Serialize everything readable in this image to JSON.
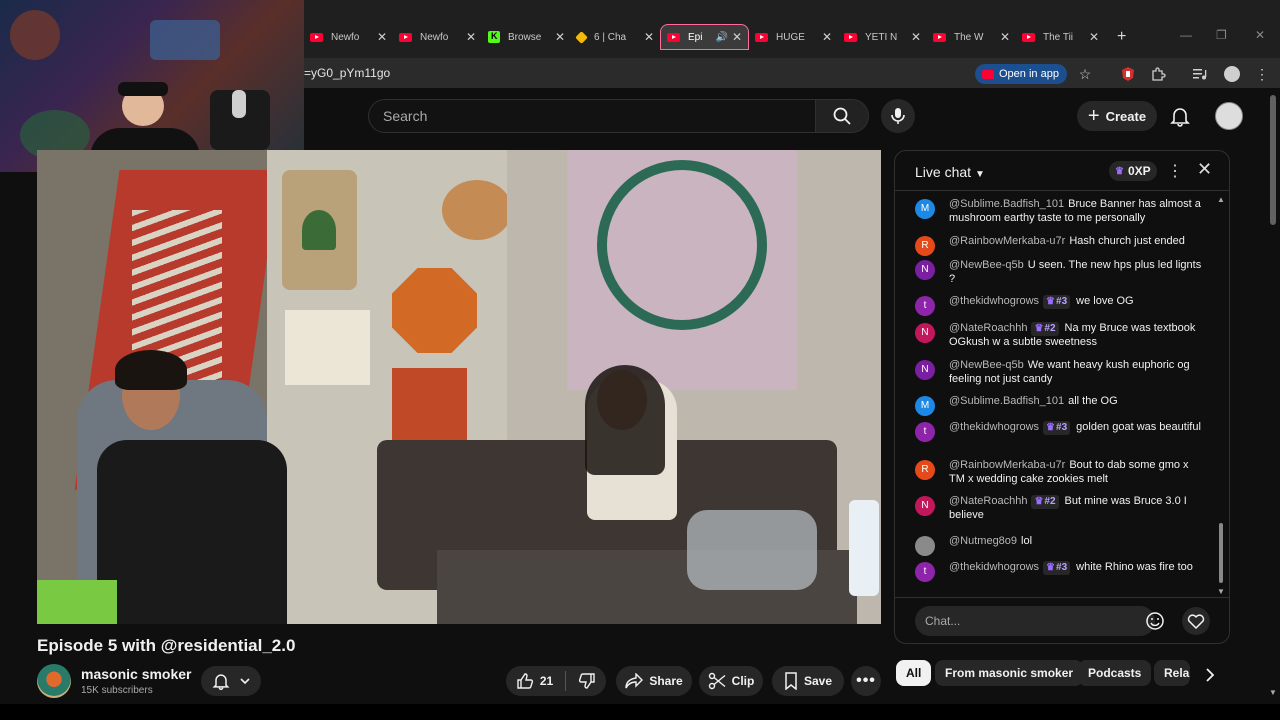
{
  "browser": {
    "tabs": [
      {
        "title": "Newfo",
        "favicon": "youtube",
        "active": false
      },
      {
        "title": "Newfo",
        "favicon": "youtube",
        "active": false
      },
      {
        "title": "Browse",
        "favicon": "kick",
        "active": false
      },
      {
        "title": "6 | Cha",
        "favicon": "binance",
        "active": false
      },
      {
        "title": "Epi",
        "favicon": "youtube",
        "active": true
      },
      {
        "title": "HUGE",
        "favicon": "youtube",
        "active": false
      },
      {
        "title": "YETI N",
        "favicon": "youtube",
        "active": false
      },
      {
        "title": "The W",
        "favicon": "youtube",
        "active": false
      },
      {
        "title": "The Tii",
        "favicon": "youtube",
        "active": false
      }
    ],
    "url": "=yG0_pYm11go",
    "open_in_app": "Open in app"
  },
  "header": {
    "search_placeholder": "Search",
    "create_label": "Create"
  },
  "video": {
    "title": "Episode 5 with @residential_2.0",
    "channel_name": "masonic smoker",
    "subscribers": "15K subscribers",
    "likes": "21",
    "share_label": "Share",
    "clip_label": "Clip",
    "save_label": "Save"
  },
  "chat": {
    "title": "Live chat",
    "xp": "0XP",
    "input_placeholder": "Chat...",
    "messages": [
      {
        "author": "@Sublime.Badfish_101",
        "badge": "",
        "text": "Bruce Banner has almost a mushroom earthy taste to me personally",
        "initial": "M",
        "color": "#1e88e5"
      },
      {
        "author": "@RainbowMerkaba-u7r",
        "badge": "",
        "text": "Hash church just ended",
        "initial": "R",
        "color": "#e64a19"
      },
      {
        "author": "@NewBee-q5b",
        "badge": "",
        "text": "U seen. The new hps plus led lignts ?",
        "initial": "N",
        "color": "#7b1fa2"
      },
      {
        "author": "@thekidwhogrows",
        "badge": "#3",
        "text": "we love OG",
        "initial": "t",
        "color": "#8e24aa"
      },
      {
        "author": "@NateRoachhh",
        "badge": "#2",
        "text": "Na my Bruce was textbook OGkush w a subtle sweetness",
        "initial": "N",
        "color": "#c2185b"
      },
      {
        "author": "@NewBee-q5b",
        "badge": "",
        "text": "We want heavy kush euphoric og feeling not just candy",
        "initial": "N",
        "color": "#7b1fa2"
      },
      {
        "author": "@Sublime.Badfish_101",
        "badge": "",
        "text": "all the OG",
        "initial": "M",
        "color": "#1e88e5"
      },
      {
        "author": "@thekidwhogrows",
        "badge": "#3",
        "text": "golden goat was beautiful",
        "initial": "t",
        "color": "#8e24aa"
      },
      {
        "author": "@RainbowMerkaba-u7r",
        "badge": "",
        "text": "Bout to dab some gmo x TM x wedding cake zookies melt",
        "initial": "R",
        "color": "#e64a19"
      },
      {
        "author": "@NateRoachhh",
        "badge": "#2",
        "text": "But mine was Bruce 3.0 I believe",
        "initial": "N",
        "color": "#c2185b"
      },
      {
        "author": "@Nutmeg8o9",
        "badge": "",
        "text": "lol",
        "initial": "",
        "color": "#8a8a8a"
      },
      {
        "author": "@thekidwhogrows",
        "badge": "#3",
        "text": "white Rhino was fire too",
        "initial": "t",
        "color": "#8e24aa"
      }
    ]
  },
  "chips": [
    {
      "label": "All",
      "active": true
    },
    {
      "label": "From masonic smoker",
      "active": false
    },
    {
      "label": "Podcasts",
      "active": false
    },
    {
      "label": "Rela",
      "active": false
    }
  ]
}
